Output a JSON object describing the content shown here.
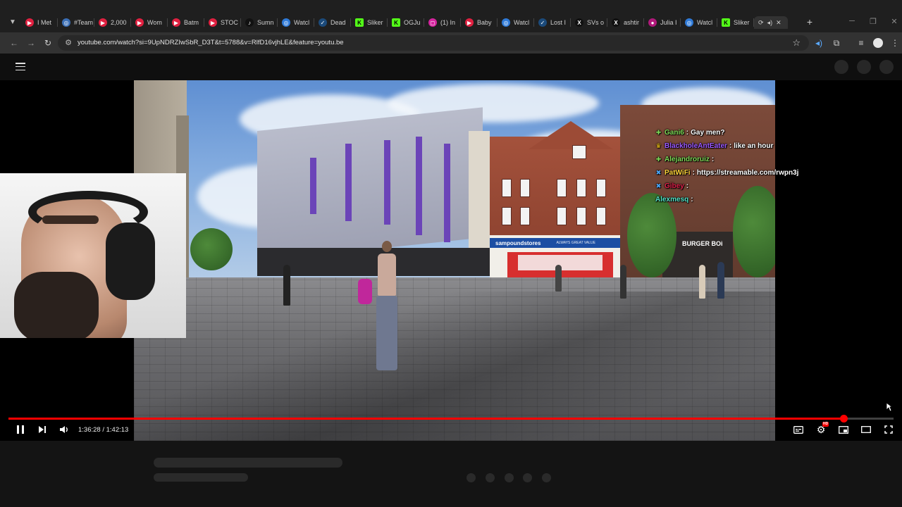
{
  "browser": {
    "tabs": [
      {
        "title": "I Met",
        "favicon": "youtube-icon",
        "color": "#e02040"
      },
      {
        "title": "#Team",
        "favicon": "globe-icon",
        "color": "#3b6fb6"
      },
      {
        "title": "2,000",
        "favicon": "youtube-icon",
        "color": "#e02040"
      },
      {
        "title": "Wom",
        "favicon": "youtube-icon",
        "color": "#e02040"
      },
      {
        "title": "Batm",
        "favicon": "youtube-icon",
        "color": "#e02040"
      },
      {
        "title": "STOC",
        "favicon": "youtube-icon",
        "color": "#e02040"
      },
      {
        "title": "Sumn",
        "favicon": "tiktok-icon",
        "color": "#111111"
      },
      {
        "title": "Watcl",
        "favicon": "globe-icon",
        "color": "#2f7ad8"
      },
      {
        "title": "Dead",
        "favicon": "steam-icon",
        "color": "#1b4a7a"
      },
      {
        "title": "Sliker",
        "favicon": "kick-icon",
        "color": "#53fc18"
      },
      {
        "title": "OGJu",
        "favicon": "kick-icon",
        "color": "#53fc18"
      },
      {
        "title": "(1) In",
        "favicon": "instagram-icon",
        "color": "#d6249f"
      },
      {
        "title": "Baby",
        "favicon": "youtube-icon",
        "color": "#e02040"
      },
      {
        "title": "Watcl",
        "favicon": "globe-icon",
        "color": "#2f7ad8"
      },
      {
        "title": "Lost I",
        "favicon": "steam-icon",
        "color": "#1b4a7a"
      },
      {
        "title": "SVs o",
        "favicon": "x-icon",
        "color": "#111111"
      },
      {
        "title": "ashtir",
        "favicon": "x-icon",
        "color": "#111111"
      },
      {
        "title": "Julia I",
        "favicon": "circle-icon",
        "color": "#b0187a"
      },
      {
        "title": "Watcl",
        "favicon": "globe-icon",
        "color": "#2f7ad8"
      },
      {
        "title": "Sliker",
        "favicon": "kick-icon",
        "color": "#53fc18"
      }
    ],
    "url": "youtube.com/watch?si=9UpNDRZIwSbR_D3T&t=5788&v=RlfD16vjhLE&feature=youtu.be"
  },
  "player": {
    "time_display": "1:36:28 / 1:42:13",
    "progress_fraction": 0.9437,
    "accent_color": "#ff0000"
  },
  "scene_signs": {
    "store_name": "sampoundstores",
    "store_tagline": "ALWAYS GREAT VALUE",
    "burger_sign": "BURGER BOi"
  },
  "chat": [
    {
      "user": "Gani6",
      "user_color": "#7ed957",
      "message": "Gay men?",
      "badge": "plus-icon",
      "badge_color": "#7ed957"
    },
    {
      "user": "BlackholeAntEater",
      "user_color": "#9b59ff",
      "message": "like an hour",
      "badge": "crown-icon",
      "badge_color": "#f5c518"
    },
    {
      "user": "Alejandroruiz",
      "user_color": "#7ed957",
      "message": "",
      "badge": "plus-icon",
      "badge_color": "#7ed957"
    },
    {
      "user": "PatWiFi",
      "user_color": "#ffd43b",
      "message": "https://streamable.com/rwpn3j",
      "badge": "x-icon",
      "badge_color": "#4aa8ff"
    },
    {
      "user": "Gibey",
      "user_color": "#e0204a",
      "message": "",
      "badge": "x-icon",
      "badge_color": "#4aa8ff"
    },
    {
      "user": "Alexmesq",
      "user_color": "#52e0c4",
      "message": "",
      "badge": "",
      "badge_color": "#52e0c4"
    }
  ]
}
